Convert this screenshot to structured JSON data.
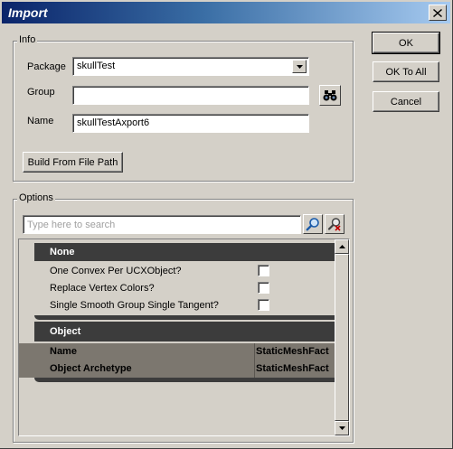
{
  "window": {
    "title": "Import"
  },
  "info": {
    "group_label": "Info",
    "package_label": "Package",
    "package_value": "skullTest",
    "group_field_label": "Group",
    "group_value": "",
    "name_label": "Name",
    "name_value": "skullTestAxport6",
    "build_button": "Build From File Path"
  },
  "buttons": {
    "ok": "OK",
    "ok_to_all": "OK To All",
    "cancel": "Cancel"
  },
  "options": {
    "group_label": "Options",
    "search_placeholder": "Type here to search",
    "categories": [
      {
        "name": "None",
        "properties": [
          {
            "name": "One Convex Per UCXObject?",
            "checked": false
          },
          {
            "name": "Replace Vertex Colors?",
            "checked": false
          },
          {
            "name": "Single Smooth Group Single Tangent?",
            "checked": false
          }
        ]
      },
      {
        "name": "Object",
        "properties": [
          {
            "name": "Name",
            "value": "StaticMeshFact"
          },
          {
            "name": "Object Archetype",
            "value": "StaticMeshFact"
          }
        ]
      }
    ]
  },
  "icons": {
    "close": "close-icon",
    "combo_arrow": "chevron-down-icon",
    "browse": "binoculars-icon",
    "search": "search-icon",
    "clear_search": "clear-search-icon",
    "scroll_up": "scroll-up-icon",
    "scroll_down": "scroll-down-icon"
  },
  "colors": {
    "title_start": "#0a246a",
    "title_end": "#a6caf0",
    "face": "#d4d0c8",
    "category_header": "#3c3c3c"
  }
}
